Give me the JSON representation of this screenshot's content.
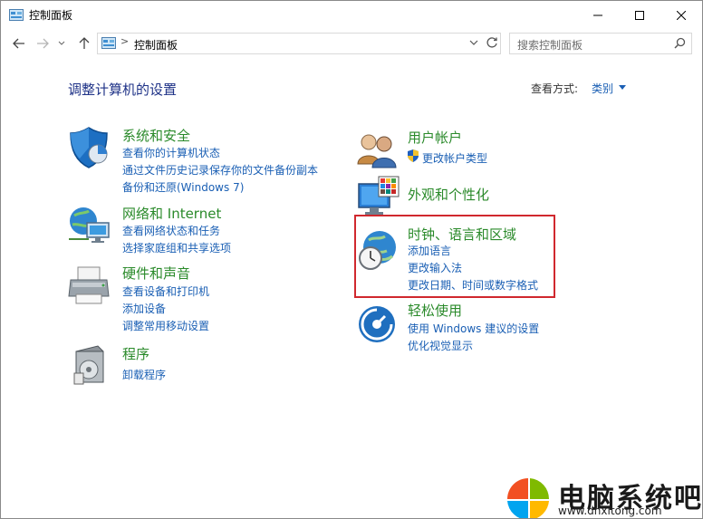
{
  "window": {
    "title": "控制面板"
  },
  "address": {
    "separator": ">",
    "path": "控制面板"
  },
  "search": {
    "placeholder": "搜索控制面板"
  },
  "main": {
    "heading": "调整计算机的设置",
    "view_by_label": "查看方式:",
    "view_by_value": "类别"
  },
  "categories": {
    "system": {
      "title": "系统和安全",
      "links": [
        "查看你的计算机状态",
        "通过文件历史记录保存你的文件备份副本",
        "备份和还原(Windows 7)"
      ]
    },
    "network": {
      "title": "网络和 Internet",
      "links": [
        "查看网络状态和任务",
        "选择家庭组和共享选项"
      ]
    },
    "hardware": {
      "title": "硬件和声音",
      "links": [
        "查看设备和打印机",
        "添加设备",
        "调整常用移动设置"
      ]
    },
    "programs": {
      "title": "程序",
      "links": [
        "卸载程序"
      ]
    },
    "users": {
      "title": "用户帐户",
      "links": [
        "更改帐户类型"
      ]
    },
    "appearance": {
      "title": "外观和个性化",
      "links": []
    },
    "clock": {
      "title": "时钟、语言和区域",
      "links": [
        "添加语言",
        "更改输入法",
        "更改日期、时间或数字格式"
      ]
    },
    "ease": {
      "title": "轻松使用",
      "links": [
        "使用 Windows 建议的设置",
        "优化视觉显示"
      ]
    }
  },
  "watermark": {
    "text": "电脑系统吧",
    "url": "www.dnxitong.com"
  },
  "colors": {
    "heading": "#1e3287",
    "category_title": "#2a8a2a",
    "link": "#1a5fb4",
    "highlight_border": "#d0282e"
  }
}
